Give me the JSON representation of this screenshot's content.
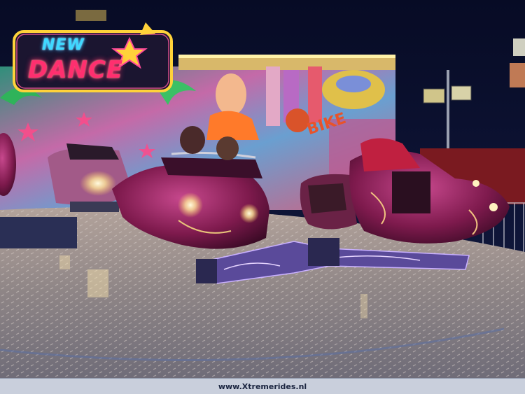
{
  "photo": {
    "sign": {
      "line1": "NEW",
      "line2": "DANCE"
    },
    "backdrop_text": "BIKE",
    "watermark": "www.Xtremerides.nl"
  },
  "colors": {
    "sky": "#0b1030",
    "platform": "#9a8b8a",
    "car_body": "#8a1f52",
    "neon_blue": "#3fd9ff",
    "neon_pink": "#ff2f6f",
    "neon_yellow": "#ffd23a"
  }
}
